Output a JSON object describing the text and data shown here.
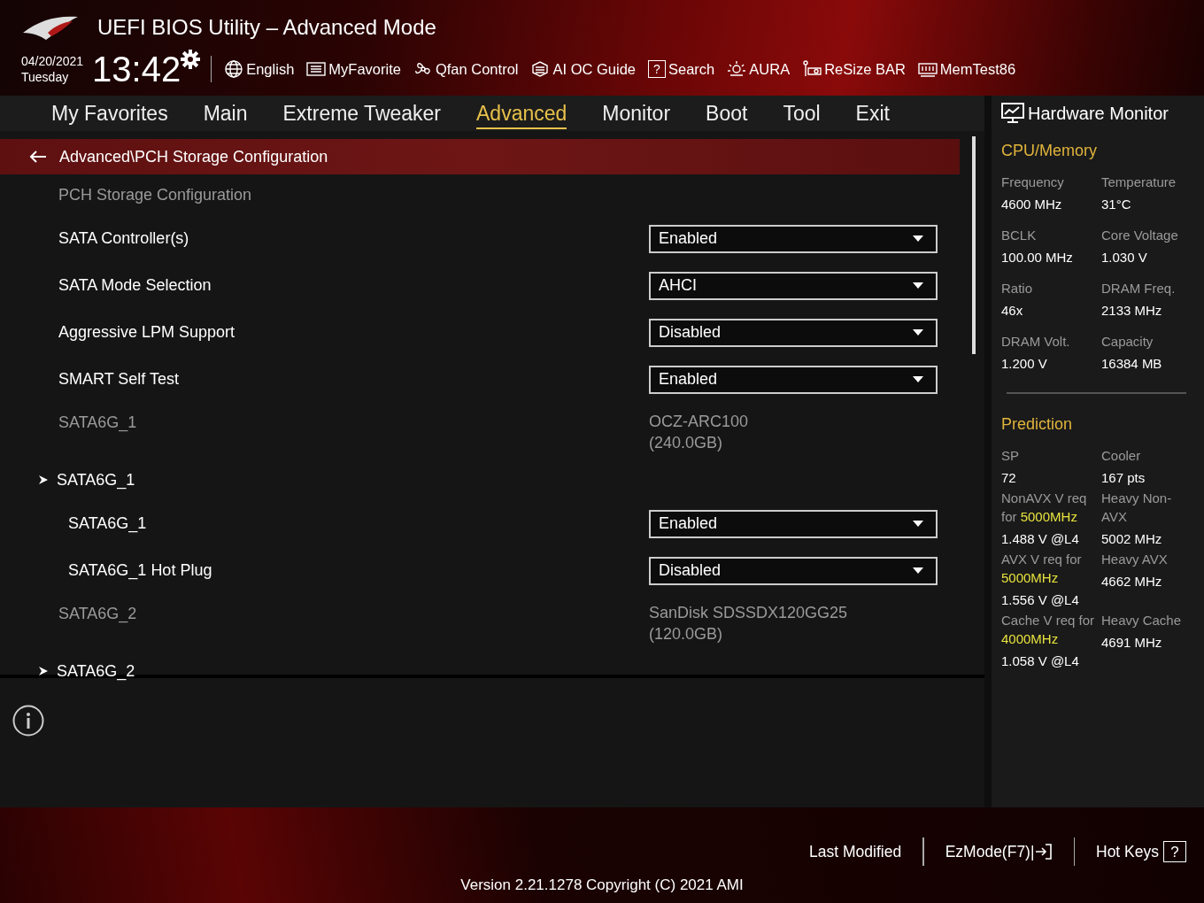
{
  "window": {
    "title": "UEFI BIOS Utility – Advanced Mode"
  },
  "clock": {
    "date": "04/20/2021",
    "day": "Tuesday",
    "time": "13:42"
  },
  "toolbar": [
    {
      "label": "English"
    },
    {
      "label": "MyFavorite"
    },
    {
      "label": "Qfan Control"
    },
    {
      "label": "AI OC Guide"
    },
    {
      "label": "Search",
      "glyph": "?"
    },
    {
      "label": "AURA"
    },
    {
      "label": "ReSize BAR"
    },
    {
      "label": "MemTest86"
    }
  ],
  "tabs": [
    {
      "label": "My Favorites",
      "selected": false
    },
    {
      "label": "Main",
      "selected": false
    },
    {
      "label": "Extreme Tweaker",
      "selected": false
    },
    {
      "label": "Advanced",
      "selected": true
    },
    {
      "label": "Monitor",
      "selected": false
    },
    {
      "label": "Boot",
      "selected": false
    },
    {
      "label": "Tool",
      "selected": false
    },
    {
      "label": "Exit",
      "selected": false
    }
  ],
  "breadcrumb": "Advanced\\PCH Storage Configuration",
  "settings": [
    {
      "kind": "heading",
      "label": "PCH Storage Configuration"
    },
    {
      "kind": "dropdown",
      "label": "SATA Controller(s)",
      "value": "Enabled"
    },
    {
      "kind": "dropdown",
      "label": "SATA Mode Selection",
      "value": "AHCI"
    },
    {
      "kind": "dropdown",
      "label": "Aggressive LPM Support",
      "value": "Disabled"
    },
    {
      "kind": "dropdown",
      "label": "SMART Self Test",
      "value": "Enabled"
    },
    {
      "kind": "info",
      "label": "SATA6G_1",
      "lines": [
        "OCZ-ARC100",
        "(240.0GB)"
      ]
    },
    {
      "kind": "submenu",
      "label": "SATA6G_1",
      "children": [
        {
          "kind": "dropdown",
          "label": "SATA6G_1",
          "value": "Enabled"
        },
        {
          "kind": "dropdown",
          "label": "SATA6G_1 Hot Plug",
          "value": "Disabled"
        }
      ]
    },
    {
      "kind": "info",
      "label": "SATA6G_2",
      "lines": [
        "SanDisk SDSSDX120GG25",
        "(120.0GB)"
      ]
    },
    {
      "kind": "submenu",
      "label": "SATA6G_2"
    }
  ],
  "hardware_monitor": {
    "title": "Hardware Monitor",
    "sections": [
      {
        "title": "CPU/Memory",
        "items": [
          {
            "label": "Frequency",
            "value": "4600 MHz"
          },
          {
            "label": "Temperature",
            "value": "31°C"
          },
          {
            "label": "BCLK",
            "value": "100.00 MHz"
          },
          {
            "label": "Core Voltage",
            "value": "1.030 V"
          },
          {
            "label": "Ratio",
            "value": "46x"
          },
          {
            "label": "DRAM Freq.",
            "value": "2133 MHz"
          },
          {
            "label": "DRAM Volt.",
            "value": "1.200 V"
          },
          {
            "label": "Capacity",
            "value": "16384 MB"
          }
        ]
      },
      {
        "title": "Prediction",
        "items": [
          {
            "label": "SP",
            "value": "72"
          },
          {
            "label": "Cooler",
            "value": "167 pts"
          },
          {
            "label": "NonAVX V req for",
            "highlight": "5000MHz",
            "value": "1.488 V @L4"
          },
          {
            "label": "Heavy Non-AVX",
            "value": "5002 MHz"
          },
          {
            "label": "AVX V req for",
            "highlight": "5000MHz",
            "value": "1.556 V @L4"
          },
          {
            "label": "Heavy AVX",
            "value": "4662 MHz"
          },
          {
            "label": "Cache V req for",
            "highlight": "4000MHz",
            "value": "1.058 V @L4"
          },
          {
            "label": "Heavy Cache",
            "value": "4691 MHz"
          }
        ]
      }
    ]
  },
  "footer": {
    "last_modified": "Last Modified",
    "ez_mode": "EzMode(F7)|",
    "hot_keys": "Hot Keys",
    "hot_keys_glyph": "?",
    "version": "Version 2.21.1278 Copyright (C) 2021 AMI"
  }
}
